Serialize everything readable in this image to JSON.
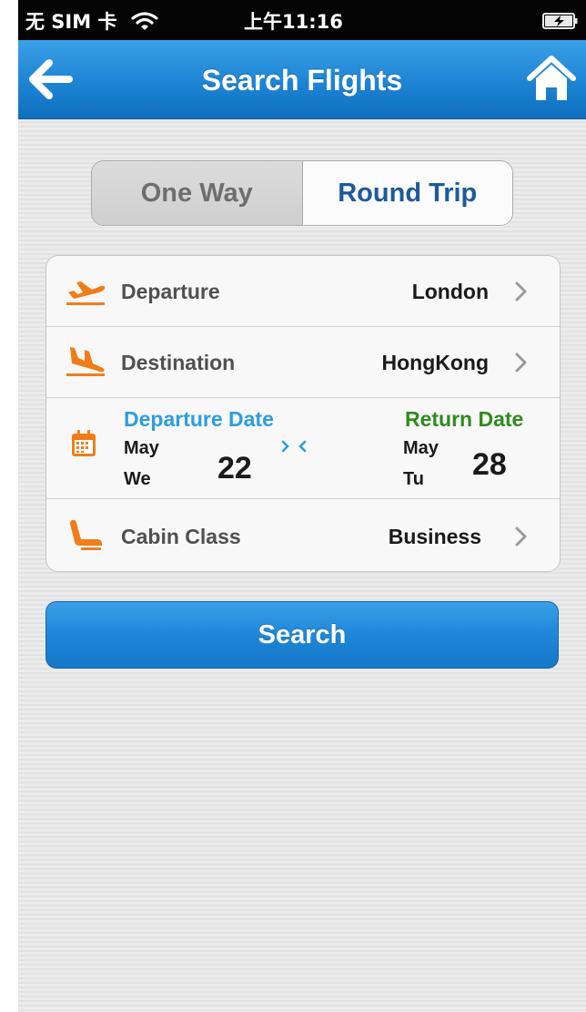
{
  "status_bar": {
    "carrier": "无 SIM 卡",
    "time": "上午11:16",
    "wifi_icon": "wifi-icon",
    "battery_icon": "battery-charging-icon"
  },
  "nav": {
    "back_icon": "arrow-left-icon",
    "title": "Search Flights",
    "home_icon": "home-icon"
  },
  "trip_type": {
    "options": [
      "One Way",
      "Round Trip"
    ],
    "selected": "Round Trip"
  },
  "form": {
    "departure": {
      "icon": "plane-takeoff-icon",
      "label": "Departure",
      "value": "London"
    },
    "destination": {
      "icon": "plane-landing-icon",
      "label": "Destination",
      "value": "HongKong"
    },
    "dates": {
      "icon": "calendar-icon",
      "departure_label": "Departure Date",
      "departure_month": "May",
      "departure_weekday": "We",
      "departure_day": "22",
      "return_label": "Return Date",
      "return_month": "May",
      "return_weekday": "Tu",
      "return_day": "28"
    },
    "cabin": {
      "icon": "seat-icon",
      "label": "Cabin Class",
      "value": "Business"
    }
  },
  "search_button": "Search",
  "colors": {
    "accent_blue": "#1f86d8",
    "departure_date_label": "#2a9ee0",
    "return_date_label": "#2e8b1e",
    "icon_orange": "#f07d1a",
    "selected_segment_text": "#1c5a9c"
  }
}
